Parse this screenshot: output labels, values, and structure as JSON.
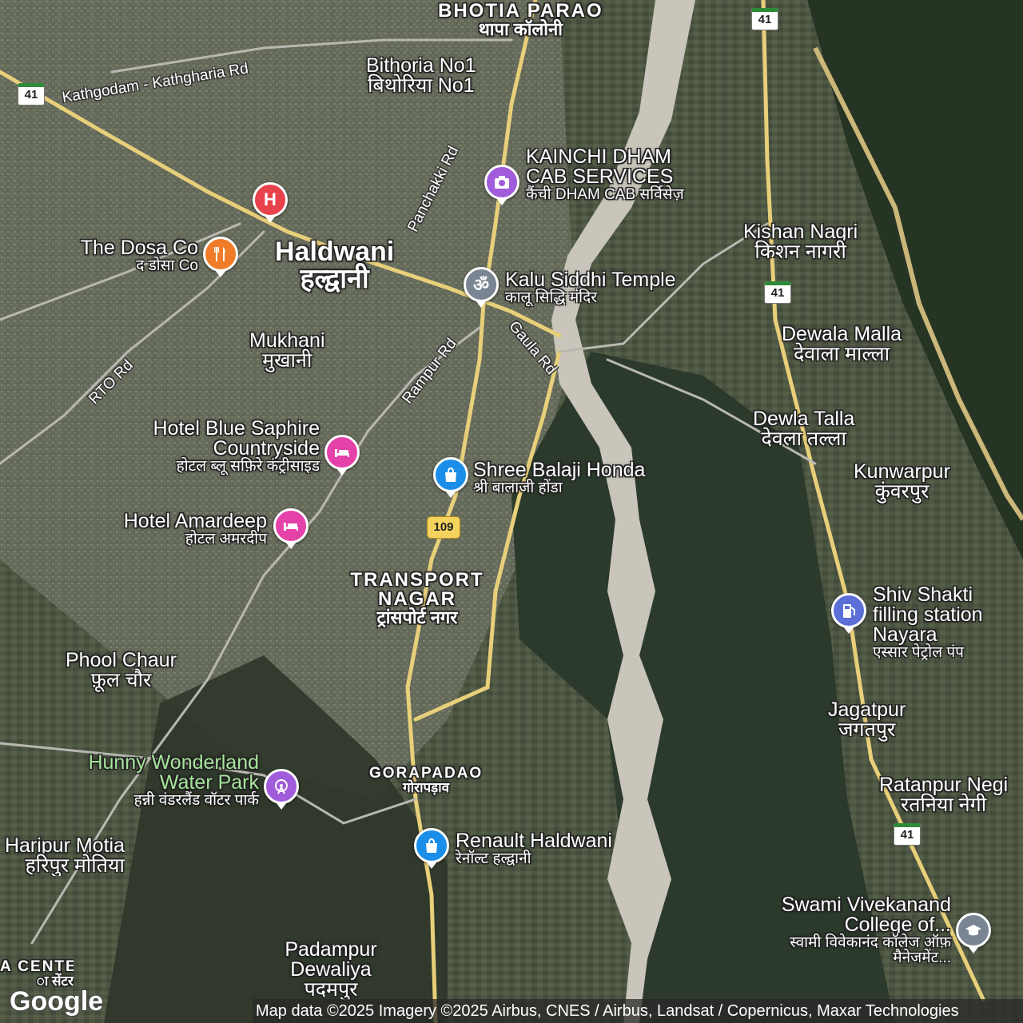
{
  "places": [
    {
      "id": "bhotia-parao",
      "en": "BHOTIA PARAO",
      "hi": "थापा कॉलोनी"
    },
    {
      "id": "bithoria",
      "en": "Bithoria No1",
      "hi": "बिथोरिया No1"
    },
    {
      "id": "haldwani",
      "en": "Haldwani",
      "hi": "हल्द्वानी"
    },
    {
      "id": "mukhani",
      "en": "Mukhani",
      "hi": "मुखानी"
    },
    {
      "id": "kishan-nagri",
      "en": "Kishan Nagri",
      "hi": "किशन नागरी"
    },
    {
      "id": "dewala-malla",
      "en": "Dewala Malla",
      "hi": "देवाला माल्ला"
    },
    {
      "id": "dewla-talla",
      "en": "Dewla Talla",
      "hi": "देवला तल्ला"
    },
    {
      "id": "kunwarpur",
      "en": "Kunwarpur",
      "hi": "कुंवरपुर"
    },
    {
      "id": "transport-nagar",
      "en": "TRANSPORT NAGAR",
      "hi": "ट्रांसपोर्ट नगर"
    },
    {
      "id": "phool-chaur",
      "en": "Phool Chaur",
      "hi": "फ़ूल चौर"
    },
    {
      "id": "gorapadao",
      "en": "GORAPADAO",
      "hi": "गोरापड़ाव"
    },
    {
      "id": "jagatpur",
      "en": "Jagatpur",
      "hi": "जगतपुर"
    },
    {
      "id": "ratanpur-negi",
      "en": "Ratanpur Negi",
      "hi": "रतनिया नेगी"
    },
    {
      "id": "haripur-motia",
      "en": "Haripur Motia",
      "hi": "हरिपुर मोतिया"
    },
    {
      "id": "padampur",
      "en": "Padampur Dewaliya",
      "hi": "पदमपुर"
    },
    {
      "id": "a-center",
      "en": "A CENTER",
      "hi": "ा सेंटर"
    }
  ],
  "pois": [
    {
      "id": "kainchi-dham",
      "en": "KAINCHI DHAM CAB SERVICES",
      "hi": "कैंची DHAM CAB सर्विसेज़",
      "icon": "camera-icon",
      "color": "#a05cdb"
    },
    {
      "id": "dosa-co",
      "en": "The Dosa Co",
      "hi": "द डोसा Co",
      "icon": "restaurant-icon",
      "color": "#f07c2a"
    },
    {
      "id": "hospital",
      "en": "",
      "hi": "",
      "icon": "hospital-icon",
      "color": "#e8424a"
    },
    {
      "id": "kalu-siddhi",
      "en": "Kalu Siddhi Temple",
      "hi": "कालू सिद्धि मंदिर",
      "icon": "om-icon",
      "color": "#7a8593"
    },
    {
      "id": "blue-saphire",
      "en": "Hotel Blue Saphire Countryside",
      "hi": "होटल ब्लू सफ़िरे कंट्रीसाइड",
      "icon": "bed-icon",
      "color": "#e542a9"
    },
    {
      "id": "amardeep",
      "en": "Hotel Amardeep",
      "hi": "होटल अमरदीप",
      "icon": "bed-icon",
      "color": "#e542a9"
    },
    {
      "id": "balaji-honda",
      "en": "Shree Balaji Honda",
      "hi": "श्री बालाजी होंडा",
      "icon": "shopping-bag-icon",
      "color": "#1a8ee8"
    },
    {
      "id": "shiv-shakti",
      "en": "Shiv Shakti filling station Nayara",
      "hi": "एस्सार पेट्रोल पंप",
      "icon": "fuel-icon",
      "color": "#5c6fd6"
    },
    {
      "id": "hunny-wonderland",
      "en": "Hunny Wonderland Water Park",
      "hi": "हन्नी वंडरलैंड वॉटर पार्क",
      "icon": "amusement-icon",
      "color": "#a05cdb"
    },
    {
      "id": "renault",
      "en": "Renault Haldwani",
      "hi": "रेनॉल्ट हल्द्वानी",
      "icon": "shopping-bag-icon",
      "color": "#1a8ee8"
    },
    {
      "id": "swami-vivekanand",
      "en": "Swami Vivekanand College of...",
      "hi": "स्वामी विवेकानंद कॉलेज ऑफ़ मैनेजमेंट...",
      "icon": "school-icon",
      "color": "#7a8593"
    }
  ],
  "roads": [
    {
      "id": "kathgodam-rd",
      "label": "Kathgodam - Kathgharia Rd"
    },
    {
      "id": "panchakki-rd",
      "label": "Panchakki Rd"
    },
    {
      "id": "rto-rd",
      "label": "RTO Rd"
    },
    {
      "id": "rampur-rd",
      "label": "Rampur Rd"
    },
    {
      "id": "gaula-rd",
      "label": "Gaula Rd"
    }
  ],
  "shields": [
    "41",
    "41",
    "41",
    "41",
    "109"
  ],
  "attribution": "Map data ©2025 Imagery ©2025 Airbus, CNES / Airbus, Landsat / Copernicus, Maxar Technologies",
  "logo": "Google",
  "colors": {
    "forest": "#2f3a2c",
    "river": "#c9c5bb",
    "road_major": "#e8cf7a",
    "field": "#4a5240"
  }
}
